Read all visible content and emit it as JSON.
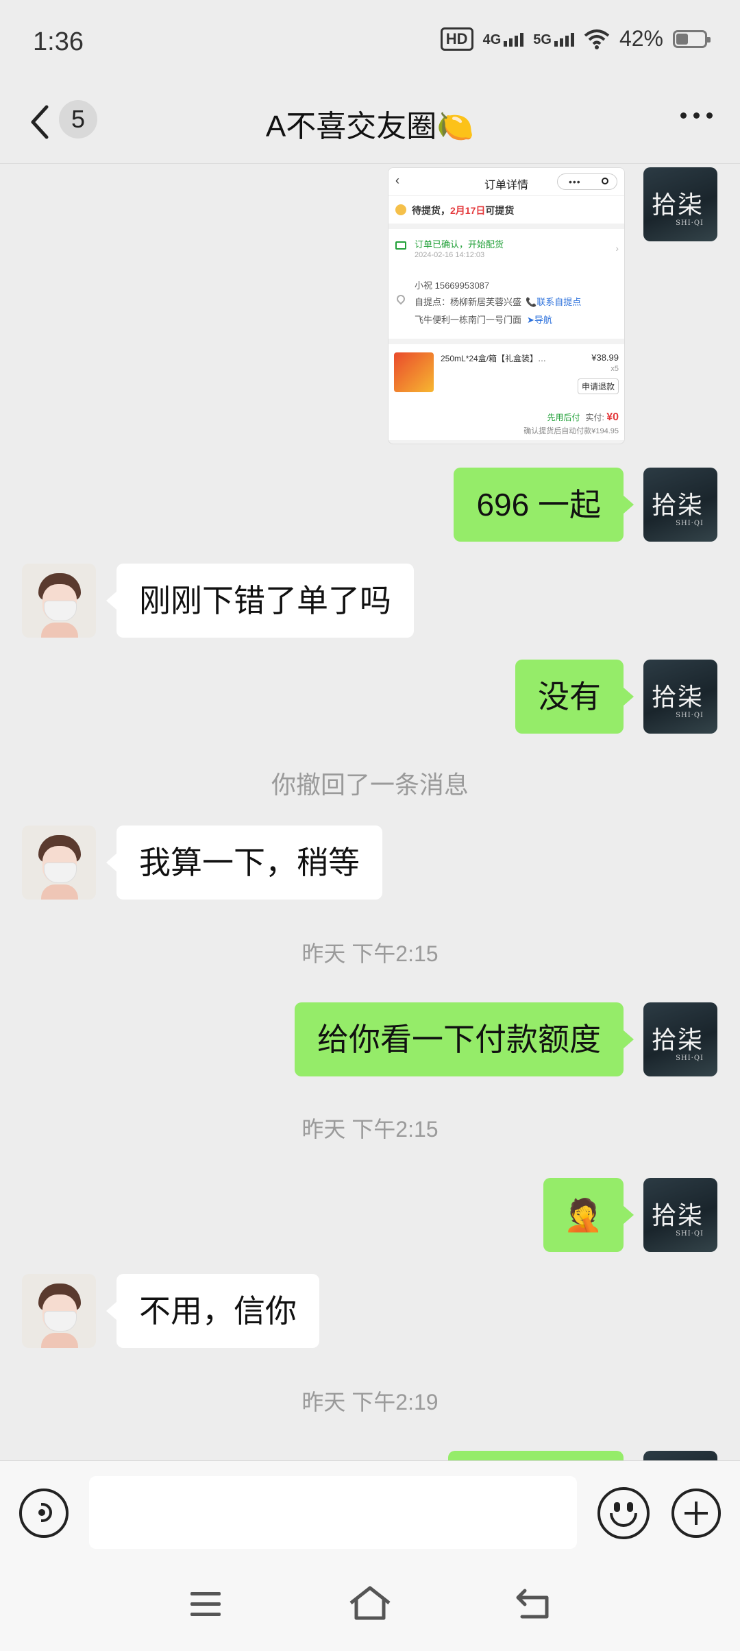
{
  "status_bar": {
    "time": "1:36",
    "hd_label": "HD",
    "net1": "4G",
    "net2": "5G",
    "battery_text": "42%",
    "battery_level": 0.42
  },
  "header": {
    "unread_count": "5",
    "title": "A不喜交友圈🍋"
  },
  "order_screenshot": {
    "page_title": "订单详情",
    "pickup_status": "待提货，",
    "pickup_date": "2月17日",
    "pickup_suffix": "可提货",
    "confirm_text": "订单已确认，开始配货",
    "confirm_time": "2024-02-16 14:12:03",
    "contact": "小祝  15669953087",
    "pickup_point": "自提点：杨柳新居芙蓉兴盛",
    "contact_link": "📞联系自提点",
    "shop": "飞牛便利一栋南门一号门面",
    "nav_link": "➤导航",
    "product_name": "250mL*24盒/箱【礼盒装】…",
    "price": "¥38.99",
    "qty": "x5",
    "refund_button": "申请退款",
    "pay_later": "先用后付",
    "paid_label": "实付:",
    "paid_amount": "¥0",
    "auto_pay": "确认提货后自动付款¥194.95"
  },
  "messages": {
    "m1": "696 一起",
    "m2": "刚刚下错了单了吗",
    "m3": "没有",
    "recall": "你撤回了一条消息",
    "m4": "我算一下，稍等",
    "time1": "昨天 下午2:15",
    "m5": "给你看一下付款额度",
    "time2": "昨天 下午2:15",
    "m6": "🤦",
    "m7": "不用，信你",
    "time3": "昨天 下午2:19"
  },
  "avatar_me": {
    "brand": "拾柒",
    "brand_sub": "SHI·QI"
  },
  "input_bar": {
    "placeholder": ""
  },
  "icons": {
    "back": "chevron-left-icon",
    "more": "more-dots-icon",
    "voice": "voice-icon",
    "emoji": "emoji-icon",
    "plus": "plus-icon",
    "menu": "menu-icon",
    "home": "home-icon",
    "nav_back": "back-icon"
  }
}
